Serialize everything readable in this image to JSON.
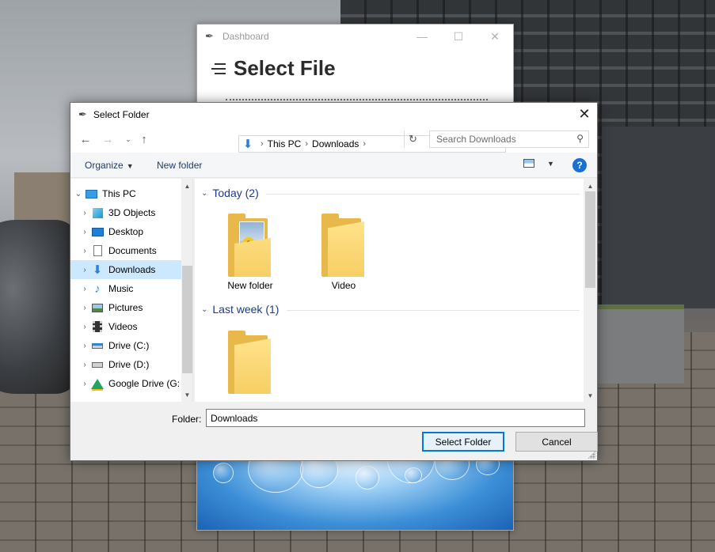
{
  "background_window": {
    "title": "Dashboard",
    "heading": "Select File",
    "controls": {
      "minimize": "—",
      "maximize": "☐",
      "close": "✕"
    }
  },
  "dialog": {
    "title": "Select Folder",
    "close_glyph": "✕",
    "address": {
      "crumbs": [
        "This PC",
        "Downloads"
      ],
      "separator": "›"
    },
    "search": {
      "placeholder": "Search Downloads"
    },
    "toolbar": {
      "organize": "Organize",
      "new_folder": "New folder",
      "help": "?"
    },
    "sidebar": {
      "items": [
        {
          "label": "This PC",
          "icon": "computer-icon"
        },
        {
          "label": "3D Objects",
          "icon": "cube-icon"
        },
        {
          "label": "Desktop",
          "icon": "desktop-icon"
        },
        {
          "label": "Documents",
          "icon": "document-icon"
        },
        {
          "label": "Downloads",
          "icon": "download-icon",
          "selected": true
        },
        {
          "label": "Music",
          "icon": "music-note-icon"
        },
        {
          "label": "Pictures",
          "icon": "picture-icon"
        },
        {
          "label": "Videos",
          "icon": "film-icon"
        },
        {
          "label": "Drive (C:)",
          "icon": "drive-icon"
        },
        {
          "label": "Drive (D:)",
          "icon": "drive-icon"
        },
        {
          "label": "Google Drive (G:",
          "icon": "google-drive-icon"
        }
      ]
    },
    "content": {
      "groups": [
        {
          "header": "Today (2)",
          "items": [
            "New folder",
            "Video"
          ]
        },
        {
          "header": "Last week (1)",
          "items": [
            ""
          ]
        }
      ]
    },
    "footer": {
      "folder_label": "Folder:",
      "folder_value": "Downloads",
      "select_button": "Select Folder",
      "cancel_button": "Cancel"
    }
  },
  "colors": {
    "accent": "#0078d7",
    "selection": "#cce8ff",
    "folder_yellow": "#f7cf64",
    "group_header": "#1e3a8a"
  }
}
